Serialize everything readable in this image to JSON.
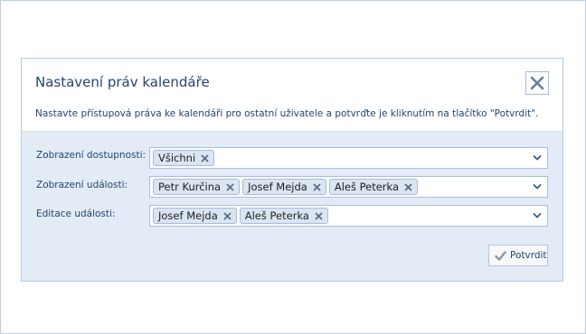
{
  "dialog": {
    "title": "Nastavení práv kalendáře",
    "description": "Nastavte přístupová práva ke kalendáři pro ostatní uživatele a potvrďte je kliknutím na tlačítko \"Potvrdit\"."
  },
  "rows": [
    {
      "label": "Zobrazení dostupnosti:",
      "chips": [
        "Všichni"
      ]
    },
    {
      "label": "Zobrazení události:",
      "chips": [
        "Petr Kurčina",
        "Josef Mejda",
        "Aleš Peterka"
      ]
    },
    {
      "label": "Editace události:",
      "chips": [
        "Josef Mejda",
        "Aleš Peterka"
      ]
    }
  ],
  "confirm_button": {
    "label": "Potvrdit"
  },
  "icons": {
    "close": "close-icon",
    "remove": "remove-x-icon",
    "dropdown": "chevron-down-icon",
    "confirm": "check-icon"
  },
  "colors": {
    "title": "#24446d",
    "panel_bg": "#e3ebf7",
    "chip_bg": "#dbe5f2"
  }
}
